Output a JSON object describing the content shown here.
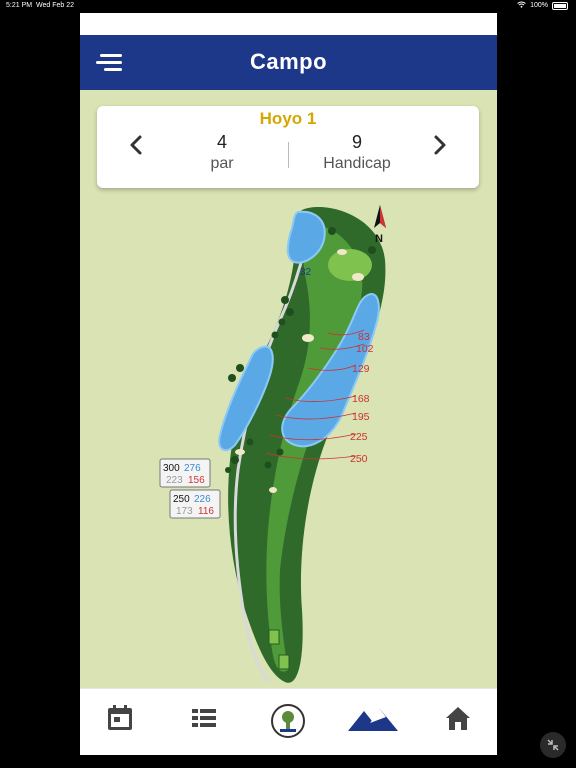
{
  "status_bar": {
    "time": "5:21 PM",
    "date": "Wed Feb 22",
    "battery": "100%"
  },
  "header": {
    "title": "Campo",
    "menu_icon": "menu-icon"
  },
  "hole_card": {
    "hole_label": "Hoyo 1",
    "par_value": "4",
    "par_label": "par",
    "handicap_value": "9",
    "handicap_label": "Handicap"
  },
  "map": {
    "north_label": "N",
    "green_depth": "32",
    "distance_markers": [
      "83",
      "102",
      "129",
      "168",
      "195",
      "225",
      "250"
    ],
    "tee_box_1": {
      "black": "300",
      "blue": "276",
      "white": "223",
      "red": "156"
    },
    "tee_box_2": {
      "black": "250",
      "blue": "226",
      "white": "173",
      "red": "116"
    }
  },
  "tab_bar": {
    "items": [
      {
        "name": "calendar",
        "icon": "calendar-icon"
      },
      {
        "name": "list",
        "icon": "list-icon"
      },
      {
        "name": "club-logo",
        "icon": "club-logo-icon"
      },
      {
        "name": "course",
        "icon": "mountain-icon",
        "active": true
      },
      {
        "name": "home",
        "icon": "home-icon"
      }
    ]
  },
  "colors": {
    "header": "#1d3789",
    "hole_label": "#d4a800",
    "active_tab": "#1d3789",
    "inactive_tab": "#444444"
  }
}
